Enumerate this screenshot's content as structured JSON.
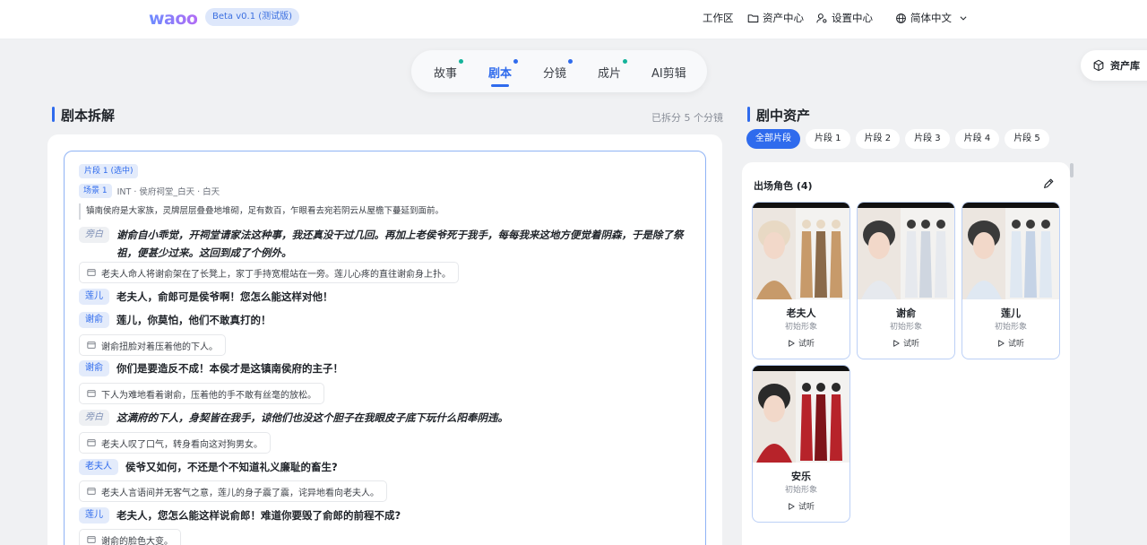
{
  "header": {
    "logo": "waoo",
    "beta_badge": "Beta v0.1 (测试版)",
    "nav": {
      "workspace": "工作区",
      "asset_center": "资产中心",
      "settings_center": "设置中心",
      "language": "简体中文"
    }
  },
  "steps": [
    {
      "label": "故事",
      "dot": true,
      "active": false
    },
    {
      "label": "剧本",
      "dot": true,
      "active": true
    },
    {
      "label": "分镜",
      "dot": true,
      "active": false
    },
    {
      "label": "成片",
      "dot": true,
      "active": false
    },
    {
      "label": "AI剪辑",
      "dot": false,
      "active": false
    }
  ],
  "asset_library_button": "资产库",
  "left": {
    "title": "剧本拆解",
    "split_info": "已拆分 5 个分镜",
    "segment_tag": "片段 1 (选中)",
    "scene_tag": "场景 1",
    "scene_location": "INT · 侯府祠堂_白天 · 白天",
    "intro": "镇南侯府是大家族，灵牌层层叠叠地堆砌，足有数百，乍眼看去宛若阴云从屋檐下蔓延到面前。",
    "lines": [
      {
        "type": "dialog",
        "speaker": "旁白",
        "narr": true,
        "text": "谢俞自小乖觉，开祠堂请家法这种事，我还真没干过几回。再加上老侯爷死于我手，每每我来这地方便觉着阴森，于是除了祭祖，便甚少过来。这回到成了个例外。"
      },
      {
        "type": "action",
        "text": "老夫人命人将谢俞架在了长凳上，家丁手持宽棍站在一旁。莲儿心疼的直往谢俞身上扑。"
      },
      {
        "type": "dialog",
        "speaker": "莲儿",
        "narr": false,
        "text": "老夫人，俞郎可是侯爷啊！您怎么能这样对他！"
      },
      {
        "type": "dialog",
        "speaker": "谢俞",
        "narr": false,
        "text": "莲儿，你莫怕，他们不敢真打的！"
      },
      {
        "type": "action",
        "text": "谢俞扭脸对着压着他的下人。"
      },
      {
        "type": "dialog",
        "speaker": "谢俞",
        "narr": false,
        "text": "你们是要造反不成！本侯才是这镇南侯府的主子！"
      },
      {
        "type": "action",
        "text": "下人为难地看着谢俞，压着他的手不敢有丝毫的放松。"
      },
      {
        "type": "dialog",
        "speaker": "旁白",
        "narr": true,
        "text": "这满府的下人，身契皆在我手，谅他们也没这个胆子在我眼皮子底下玩什么阳奉阴违。"
      },
      {
        "type": "action",
        "text": "老夫人叹了口气，转身看向这对狗男女。"
      },
      {
        "type": "dialog",
        "speaker": "老夫人",
        "narr": false,
        "text": "侯爷又如何，不还是个不知道礼义廉耻的畜生?"
      },
      {
        "type": "action",
        "text": "老夫人言语间并无客气之意，莲儿的身子震了震，诧异地看向老夫人。"
      },
      {
        "type": "dialog",
        "speaker": "莲儿",
        "narr": false,
        "text": "老夫人，您怎么能这样说俞郎！难道你要毁了俞郎的前程不成?"
      },
      {
        "type": "action",
        "text": "谢俞的脸色大变。"
      }
    ]
  },
  "right": {
    "title": "剧中资产",
    "filters": [
      "全部片段",
      "片段 1",
      "片段 2",
      "片段 3",
      "片段 4",
      "片段 5"
    ],
    "active_filter": "全部片段",
    "cast_title": "出场角色 (4)",
    "characters": [
      {
        "name": "老夫人",
        "sub": "初始形象",
        "play": "试听",
        "palette": [
          "#c79a6a",
          "#8a6a4a",
          "#e8d9c4"
        ]
      },
      {
        "name": "谢俞",
        "sub": "初始形象",
        "play": "试听",
        "palette": [
          "#e6e9ee",
          "#cfd6e0",
          "#3a3a3a"
        ]
      },
      {
        "name": "莲儿",
        "sub": "初始形象",
        "play": "试听",
        "palette": [
          "#dfe8f2",
          "#c5d3e6",
          "#3a3a3a"
        ]
      },
      {
        "name": "安乐",
        "sub": "初始形象",
        "play": "试听",
        "palette": [
          "#b7232a",
          "#7e1419",
          "#2a2a2a"
        ]
      }
    ]
  }
}
